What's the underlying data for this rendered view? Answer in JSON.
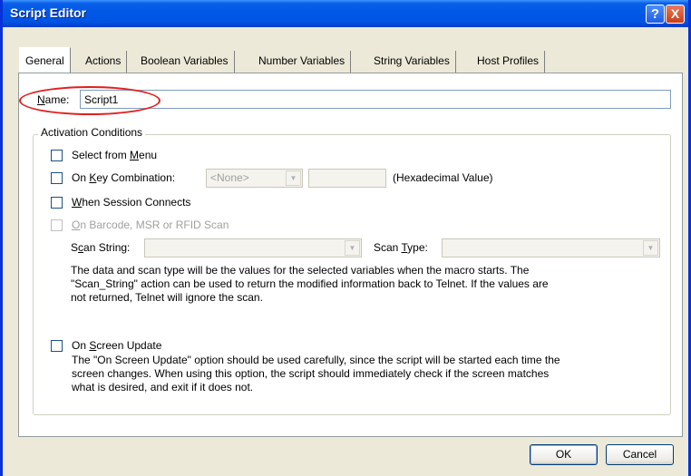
{
  "window": {
    "title": "Script Editor"
  },
  "titlebar": {
    "help_label": "?",
    "close_label": "X"
  },
  "tabs": [
    {
      "label": "General",
      "active": true
    },
    {
      "label": "Actions"
    },
    {
      "label": "Boolean Variables"
    },
    {
      "label": "Number Variables"
    },
    {
      "label": "String Variables"
    },
    {
      "label": "Host Profiles"
    }
  ],
  "name_field": {
    "label_access": "N",
    "label_rest": "ame:",
    "value": "Script1"
  },
  "activation": {
    "title": "Activation Conditions",
    "select_from_menu": {
      "pre": "Select from ",
      "access": "M",
      "post": "enu"
    },
    "key_combination": {
      "pre": "On ",
      "access": "K",
      "post": "ey Combination:",
      "combo_value": "<None>",
      "hex_label": "(Hexadecimal Value)"
    },
    "session_connects": {
      "pre": "",
      "access": "W",
      "post": "hen Session Connects"
    },
    "barcode": {
      "pre": "",
      "access": "O",
      "post": "n Barcode, MSR or RFID Scan"
    },
    "scan_string": {
      "pre": "S",
      "access": "c",
      "post": "an String:"
    },
    "scan_type": {
      "pre": "Scan ",
      "access": "T",
      "post": "ype:"
    },
    "scan_info": [
      "The data and scan type will be the values for the selected variables when the macro starts.  The",
      "\"Scan_String\" action can be used to return the modified information back to Telnet.  If the values are",
      "not returned, Telnet will ignore the scan."
    ],
    "screen_update": {
      "pre": "On ",
      "access": "S",
      "post": "creen Update"
    },
    "screen_update_info": [
      "The \"On Screen Update\" option should be used carefully, since the script will be started each time the",
      "screen changes.  When using this option, the script should immediately check if the screen matches",
      "what is desired, and exit if it does not."
    ]
  },
  "buttons": {
    "ok": "OK",
    "cancel": "Cancel"
  }
}
